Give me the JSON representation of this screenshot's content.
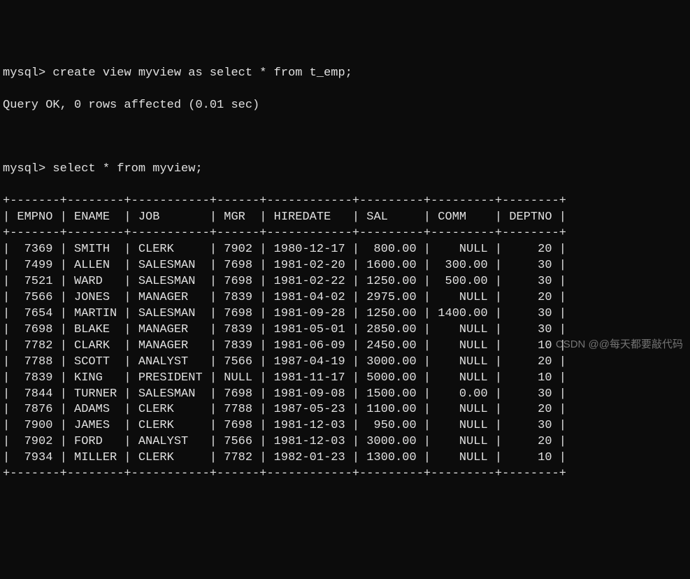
{
  "prompt": "mysql>",
  "commands": {
    "cmd1": "create view myview as select * from t_emp;",
    "result1": "Query OK, 0 rows affected (0.01 sec)",
    "cmd2": "select * from myview;"
  },
  "table": {
    "border": "+-------+--------+-----------+------+------------+---------+---------+--------+",
    "headers": [
      "EMPNO",
      "ENAME",
      "JOB",
      "MGR",
      "HIREDATE",
      "SAL",
      "COMM",
      "DEPTNO"
    ],
    "rows": [
      {
        "EMPNO": "7369",
        "ENAME": "SMITH",
        "JOB": "CLERK",
        "MGR": "7902",
        "HIREDATE": "1980-12-17",
        "SAL": "800.00",
        "COMM": "NULL",
        "DEPTNO": "20"
      },
      {
        "EMPNO": "7499",
        "ENAME": "ALLEN",
        "JOB": "SALESMAN",
        "MGR": "7698",
        "HIREDATE": "1981-02-20",
        "SAL": "1600.00",
        "COMM": "300.00",
        "DEPTNO": "30"
      },
      {
        "EMPNO": "7521",
        "ENAME": "WARD",
        "JOB": "SALESMAN",
        "MGR": "7698",
        "HIREDATE": "1981-02-22",
        "SAL": "1250.00",
        "COMM": "500.00",
        "DEPTNO": "30"
      },
      {
        "EMPNO": "7566",
        "ENAME": "JONES",
        "JOB": "MANAGER",
        "MGR": "7839",
        "HIREDATE": "1981-04-02",
        "SAL": "2975.00",
        "COMM": "NULL",
        "DEPTNO": "20"
      },
      {
        "EMPNO": "7654",
        "ENAME": "MARTIN",
        "JOB": "SALESMAN",
        "MGR": "7698",
        "HIREDATE": "1981-09-28",
        "SAL": "1250.00",
        "COMM": "1400.00",
        "DEPTNO": "30"
      },
      {
        "EMPNO": "7698",
        "ENAME": "BLAKE",
        "JOB": "MANAGER",
        "MGR": "7839",
        "HIREDATE": "1981-05-01",
        "SAL": "2850.00",
        "COMM": "NULL",
        "DEPTNO": "30"
      },
      {
        "EMPNO": "7782",
        "ENAME": "CLARK",
        "JOB": "MANAGER",
        "MGR": "7839",
        "HIREDATE": "1981-06-09",
        "SAL": "2450.00",
        "COMM": "NULL",
        "DEPTNO": "10"
      },
      {
        "EMPNO": "7788",
        "ENAME": "SCOTT",
        "JOB": "ANALYST",
        "MGR": "7566",
        "HIREDATE": "1987-04-19",
        "SAL": "3000.00",
        "COMM": "NULL",
        "DEPTNO": "20"
      },
      {
        "EMPNO": "7839",
        "ENAME": "KING",
        "JOB": "PRESIDENT",
        "MGR": "NULL",
        "HIREDATE": "1981-11-17",
        "SAL": "5000.00",
        "COMM": "NULL",
        "DEPTNO": "10"
      },
      {
        "EMPNO": "7844",
        "ENAME": "TURNER",
        "JOB": "SALESMAN",
        "MGR": "7698",
        "HIREDATE": "1981-09-08",
        "SAL": "1500.00",
        "COMM": "0.00",
        "DEPTNO": "30"
      },
      {
        "EMPNO": "7876",
        "ENAME": "ADAMS",
        "JOB": "CLERK",
        "MGR": "7788",
        "HIREDATE": "1987-05-23",
        "SAL": "1100.00",
        "COMM": "NULL",
        "DEPTNO": "20"
      },
      {
        "EMPNO": "7900",
        "ENAME": "JAMES",
        "JOB": "CLERK",
        "MGR": "7698",
        "HIREDATE": "1981-12-03",
        "SAL": "950.00",
        "COMM": "NULL",
        "DEPTNO": "30"
      },
      {
        "EMPNO": "7902",
        "ENAME": "FORD",
        "JOB": "ANALYST",
        "MGR": "7566",
        "HIREDATE": "1981-12-03",
        "SAL": "3000.00",
        "COMM": "NULL",
        "DEPTNO": "20"
      },
      {
        "EMPNO": "7934",
        "ENAME": "MILLER",
        "JOB": "CLERK",
        "MGR": "7782",
        "HIREDATE": "1982-01-23",
        "SAL": "1300.00",
        "COMM": "NULL",
        "DEPTNO": "10"
      }
    ]
  },
  "watermark": "CSDN @@每天都要敲代码",
  "col_widths": {
    "EMPNO": 7,
    "ENAME": 8,
    "JOB": 11,
    "MGR": 6,
    "HIREDATE": 12,
    "SAL": 9,
    "COMM": 9,
    "DEPTNO": 8
  }
}
